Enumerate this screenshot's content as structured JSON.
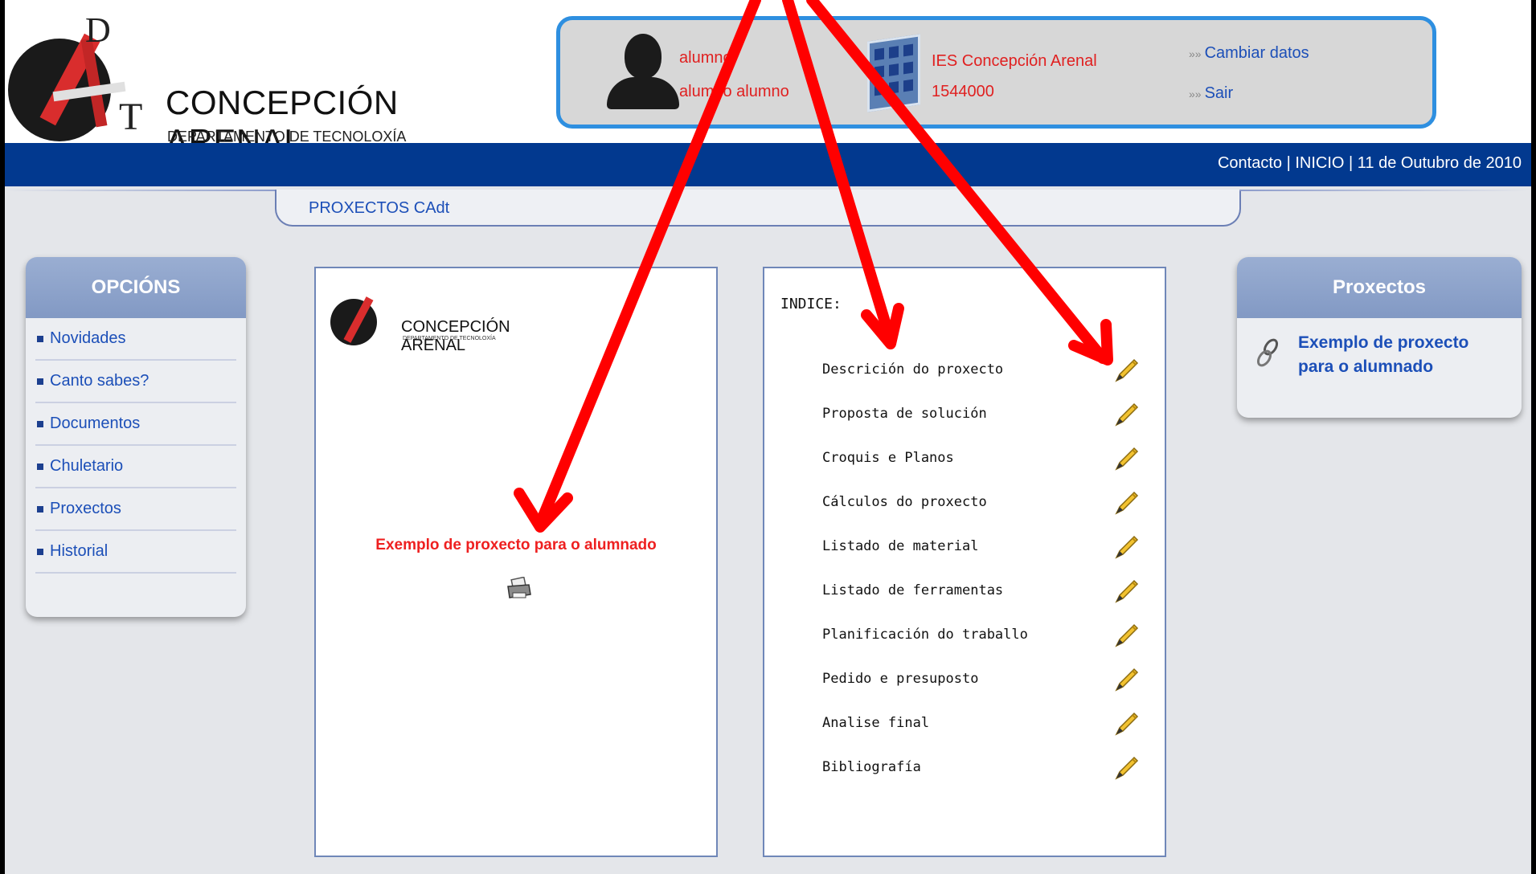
{
  "header": {
    "logo_letters": "DAT",
    "logo_title": "CONCEPCIÓN  ARENAL",
    "logo_subtitle": "DEPARTAMENTO DE TECNOLOXÍA"
  },
  "user": {
    "username": "alumno",
    "fullname": "alumno alumno",
    "school_name": "IES Concepción Arenal",
    "school_code": "1544000",
    "change_data_label": "Cambiar datos",
    "exit_label": "Sair",
    "link_prefix": "»»"
  },
  "topbar": {
    "text": "Contacto | INICIO | 11 de Outubro de 2010"
  },
  "section": {
    "title": "PROXECTOS CAdt"
  },
  "left_menu": {
    "title": "OPCIÓNS",
    "items": [
      {
        "label": "Novidades"
      },
      {
        "label": "Canto sabes?"
      },
      {
        "label": "Documentos"
      },
      {
        "label": "Chuletario"
      },
      {
        "label": "Proxectos"
      },
      {
        "label": "Historial"
      }
    ]
  },
  "project_panel": {
    "mini_logo_title": "CONCEPCIÓN  ARENAL",
    "mini_logo_subtitle": "DEPARTAMENTO DE TECNOLOXÍA",
    "project_title": "Exemplo de proxecto para o alumnado",
    "print_icon": "printer-icon"
  },
  "index_panel": {
    "heading": "INDICE:",
    "items": [
      {
        "label": "Descrición do proxecto"
      },
      {
        "label": "Proposta de solución"
      },
      {
        "label": "Croquis e Planos"
      },
      {
        "label": "Cálculos do proxecto"
      },
      {
        "label": "Listado de material"
      },
      {
        "label": "Listado de ferramentas"
      },
      {
        "label": "Planificación do traballo"
      },
      {
        "label": "Pedido e presuposto"
      },
      {
        "label": "Analise final"
      },
      {
        "label": "Bibliografía"
      }
    ],
    "edit_icon": "pencil-icon"
  },
  "right_panel": {
    "title": "Proxectos",
    "link_label": "Exemplo de proxecto para o alumnado"
  },
  "colors": {
    "accent_blue": "#02398f",
    "link_blue": "#1c4fb8",
    "highlight_red": "#ee2020",
    "arrow_red": "#ff0000"
  }
}
